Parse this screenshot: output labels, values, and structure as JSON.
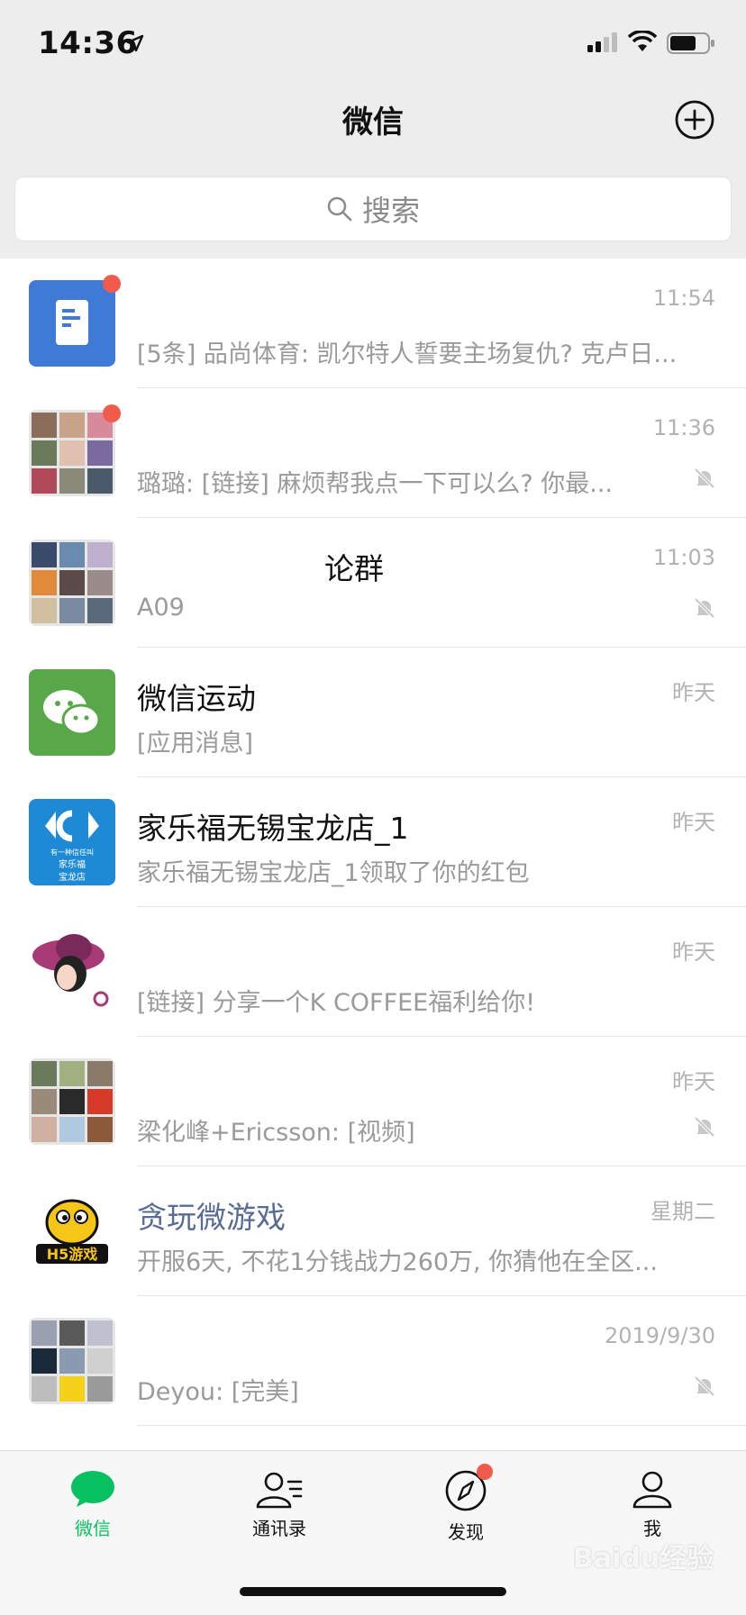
{
  "status_bar": {
    "time": "14:36"
  },
  "header": {
    "title": "微信"
  },
  "search": {
    "label": "搜索"
  },
  "chats": [
    {
      "title": "",
      "time": "11:54",
      "preview": "[5条] 品尚体育: 凯尔特人誓要主场复仇? 克卢日...",
      "badge": true,
      "muted": false
    },
    {
      "title": "",
      "time": "11:36",
      "preview": "璐璐: [链接] 麻烦帮我点一下可以么? 你最...",
      "badge": true,
      "muted": true
    },
    {
      "title": "论群",
      "time": "11:03",
      "preview": "A09",
      "badge": false,
      "muted": true
    },
    {
      "title": "微信运动",
      "time": "昨天",
      "preview": "[应用消息]",
      "badge": false,
      "muted": false
    },
    {
      "title": "家乐福无锡宝龙店_1",
      "time": "昨天",
      "preview": "家乐福无锡宝龙店_1领取了你的红包",
      "badge": false,
      "muted": false
    },
    {
      "title": "",
      "time": "昨天",
      "preview": "[链接] 分享一个K COFFEE福利给你!",
      "badge": false,
      "muted": false
    },
    {
      "title": "",
      "time": "昨天",
      "preview": "梁化峰+Ericsson: [视频]",
      "badge": false,
      "muted": true
    },
    {
      "title": "贪玩微游戏",
      "time": "星期二",
      "preview": "开服6天, 不花1分钱战力260万, 你猜他在全区...",
      "badge": false,
      "muted": false
    },
    {
      "title": "",
      "time": "2019/9/30",
      "preview": "Deyou: [完美]",
      "badge": false,
      "muted": true
    }
  ],
  "avatar_text": {
    "carrefour_line1": "有一种信任叫",
    "carrefour_line2": "家乐福",
    "carrefour_line3": "宝龙店",
    "game_logo": "H5游戏"
  },
  "tabs": [
    {
      "label": "微信",
      "active": true
    },
    {
      "label": "通讯录",
      "active": false
    },
    {
      "label": "发现",
      "active": false
    },
    {
      "label": "我",
      "active": false
    }
  ],
  "watermark": "Baidu经验",
  "colors": {
    "accent": "#07c160",
    "badge": "#f15b4c",
    "link_title": "#576b95"
  }
}
